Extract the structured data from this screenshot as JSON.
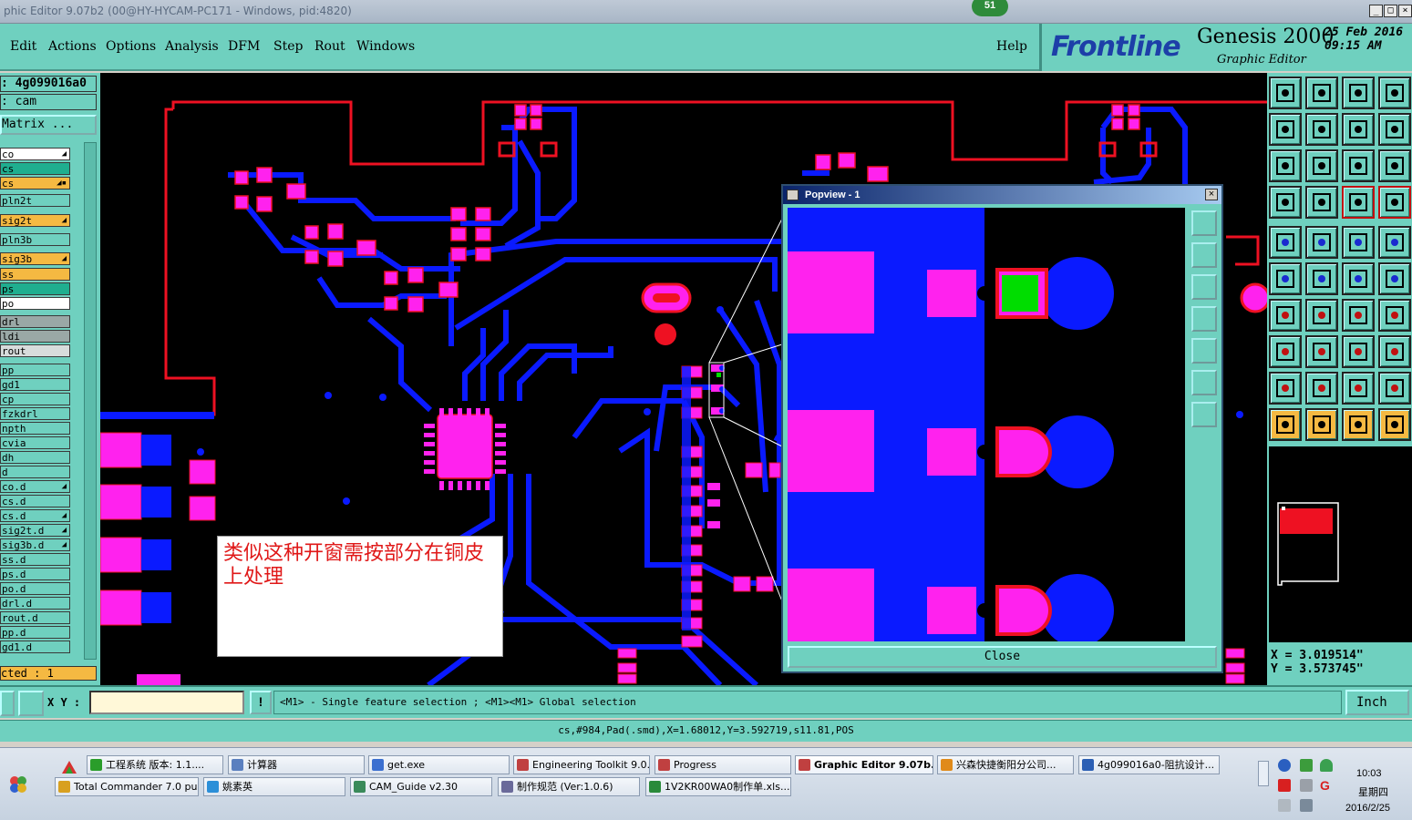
{
  "window": {
    "title": "phic Editor 9.07b2 (00@HY-HYCAM-PC171 - Windows, pid:4820)",
    "badge": "51"
  },
  "menu": {
    "items": [
      "Edit",
      "Actions",
      "Options",
      "Analysis",
      "DFM",
      "Step",
      "Rout",
      "Windows"
    ],
    "help": "Help"
  },
  "brand": {
    "logo": "Frontline",
    "product": "Genesis 2000",
    "subtitle": "Graphic Editor",
    "date": "25 Feb 2016",
    "time": "09:15 AM"
  },
  "left_panel": {
    "job": ": 4g099016a0",
    "step": ": cam",
    "matrix_button": "Matrix ...",
    "layers": [
      {
        "name": "co",
        "color": "#ffffff",
        "mark": "◢"
      },
      {
        "name": "cs",
        "color": "#1fae8f",
        "mark": ""
      },
      {
        "name": "cs",
        "color": "#f5b942",
        "mark": "◢▪"
      },
      {
        "name": "pln2t",
        "color": "#6fd0bf",
        "mark": ""
      },
      {
        "name": "sig2t",
        "color": "#f5b942",
        "mark": "◢"
      },
      {
        "name": "pln3b",
        "color": "#6fd0bf",
        "mark": ""
      },
      {
        "name": "sig3b",
        "color": "#f5b942",
        "mark": "◢"
      },
      {
        "name": "ss",
        "color": "#f5b942",
        "mark": ""
      },
      {
        "name": "ps",
        "color": "#1fae8f",
        "mark": ""
      },
      {
        "name": "po",
        "color": "#ffffff",
        "mark": ""
      },
      {
        "name": "drl",
        "color": "#9aa8a6",
        "mark": ""
      },
      {
        "name": "ldi",
        "color": "#9aa8a6",
        "mark": ""
      },
      {
        "name": "rout",
        "color": "#d8dcdc",
        "mark": ""
      },
      {
        "name": "pp",
        "color": "#6fd0bf",
        "mark": ""
      },
      {
        "name": "gd1",
        "color": "#6fd0bf",
        "mark": ""
      },
      {
        "name": "cp",
        "color": "#6fd0bf",
        "mark": ""
      },
      {
        "name": "fzkdrl",
        "color": "#6fd0bf",
        "mark": ""
      },
      {
        "name": "npth",
        "color": "#6fd0bf",
        "mark": ""
      },
      {
        "name": "cvia",
        "color": "#6fd0bf",
        "mark": ""
      },
      {
        "name": "dh",
        "color": "#6fd0bf",
        "mark": ""
      },
      {
        "name": "d",
        "color": "#6fd0bf",
        "mark": ""
      },
      {
        "name": "co.d",
        "color": "#6fd0bf",
        "mark": "◢"
      },
      {
        "name": "cs.d",
        "color": "#6fd0bf",
        "mark": ""
      },
      {
        "name": "cs.d",
        "color": "#6fd0bf",
        "mark": "◢"
      },
      {
        "name": "sig2t.d",
        "color": "#6fd0bf",
        "mark": "◢"
      },
      {
        "name": "sig3b.d",
        "color": "#6fd0bf",
        "mark": "◢"
      },
      {
        "name": "ss.d",
        "color": "#6fd0bf",
        "mark": ""
      },
      {
        "name": "ps.d",
        "color": "#6fd0bf",
        "mark": ""
      },
      {
        "name": "po.d",
        "color": "#6fd0bf",
        "mark": ""
      },
      {
        "name": "drl.d",
        "color": "#6fd0bf",
        "mark": ""
      },
      {
        "name": "rout.d",
        "color": "#6fd0bf",
        "mark": ""
      },
      {
        "name": "pp.d",
        "color": "#6fd0bf",
        "mark": ""
      },
      {
        "name": "gd1.d",
        "color": "#6fd0bf",
        "mark": ""
      }
    ],
    "selected": "cted : 1"
  },
  "note": "类似这种开窗需按部分在铜皮上处理",
  "popview": {
    "title": "Popview - 1",
    "close": "Close"
  },
  "coords": {
    "x": "X = 3.019514\"",
    "y": "Y = 3.573745\""
  },
  "status": {
    "xy_label": "X Y :",
    "xy_value": "",
    "hint": "<M1> - Single feature selection ; <M1><M1> Global selection",
    "units": "Inch",
    "feature_info": "cs,#984,Pad(.smd),X=1.68012,Y=3.592719,s11.81,POS"
  },
  "taskbar": {
    "row1": [
      {
        "label": "工程系统  版本: 1.1....",
        "color": "#2a9d2a"
      },
      {
        "label": "计算器",
        "color": "#5a7fbf"
      },
      {
        "label": "get.exe",
        "color": "#3b6fd0"
      },
      {
        "label": "Engineering Toolkit 9.0...",
        "color": "#c04040"
      },
      {
        "label": "Progress",
        "color": "#c04040"
      },
      {
        "label": "Graphic Editor 9.07b...",
        "color": "#c04040"
      },
      {
        "label": "兴森快捷衡阳分公司...",
        "color": "#e08a1a"
      },
      {
        "label": "4g099016a0-阻抗设计...",
        "color": "#2b5fb4"
      }
    ],
    "row2": [
      {
        "label": "Total Commander 7.0 pu...",
        "color": "#d8a020"
      },
      {
        "label": "姚素英",
        "color": "#2b8fd8"
      },
      {
        "label": "CAM_Guide v2.30",
        "color": "#3a8a5a"
      },
      {
        "label": "制作规范 (Ver:1.0.6)",
        "color": "#6a6a9a"
      },
      {
        "label": "1V2KR00WA0制作单.xls...",
        "color": "#2a8a3a"
      }
    ],
    "time": "10:03",
    "weekday": "星期四",
    "date": "2016/2/25"
  },
  "colors": {
    "copper": "#0a1aff",
    "pad": "#ff22ee",
    "trace_red": "#ee1122",
    "highlight": "#00dd00",
    "panel": "#6fd0bf"
  }
}
